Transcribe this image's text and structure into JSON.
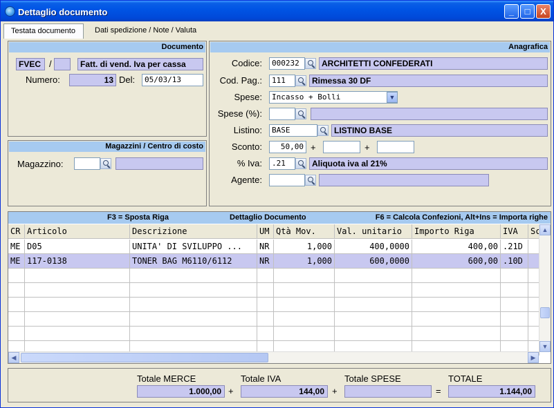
{
  "window": {
    "title": "Dettaglio documento",
    "min_glyph": "_",
    "max_glyph": "□",
    "close_glyph": "X"
  },
  "tabs": [
    {
      "label": "Testata documento",
      "active": true
    },
    {
      "label": "Dati spedizione / Note / Valuta",
      "active": false
    }
  ],
  "documento": {
    "header": "Documento",
    "tipo": "FVEC",
    "separator": "/",
    "sezionale": "",
    "descrizione_tipo": "Fatt. di vend. Iva per cassa",
    "numero_label": "Numero:",
    "numero": "13",
    "del_label": "Del:",
    "data": "05/03/13"
  },
  "magazzini": {
    "header": "Magazzini / Centro di costo",
    "magazzino_label": "Magazzino:",
    "magazzino_value": "",
    "magazzino_desc": ""
  },
  "anagrafica": {
    "header": "Anagrafica",
    "codice_label": "Codice:",
    "codice": "000232",
    "codice_desc": "ARCHITETTI CONFEDERATI",
    "codpag_label": "Cod. Pag.:",
    "codpag": "111",
    "codpag_desc": "Rimessa 30 DF",
    "spese_label": "Spese:",
    "spese": "Incasso + Bolli",
    "spese_perc_label": "Spese (%):",
    "spese_perc": "",
    "spese_perc_desc": "",
    "listino_label": "Listino:",
    "listino": "BASE",
    "listino_desc": "LISTINO BASE",
    "sconto_label": "Sconto:",
    "sconto1": "50,00",
    "plus": "+",
    "sconto2": "",
    "sconto3": "",
    "iva_label": "% Iva:",
    "iva": ".21",
    "iva_desc": "Aliquota iva al 21%",
    "agente_label": "Agente:",
    "agente": "",
    "agente_desc": ""
  },
  "grid": {
    "header_left": "F3 = Sposta Riga",
    "header_center": "Dettaglio Documento",
    "header_right": "F6 = Calcola Confezioni, Alt+Ins = Importa righe",
    "columns": [
      "CR",
      "Articolo",
      "Descrizione",
      "UM",
      "Qtà Mov.",
      "Val. unitario",
      "Importo Riga",
      "IVA",
      "Sc"
    ],
    "rows": [
      [
        "ME",
        "D05",
        "UNITA' DI SVILUPPO ...",
        "NR",
        "1,000",
        "400,0000",
        "400,00",
        ".21D"
      ],
      [
        "ME",
        "117-0138",
        "TONER BAG M6110/6112",
        "NR",
        "1,000",
        "600,0000",
        "600,00",
        ".10D"
      ]
    ],
    "selected_row": 1
  },
  "totals": {
    "merce_label": "Totale MERCE",
    "merce": "1.000,00",
    "iva_label": "Totale IVA",
    "iva": "144,00",
    "spese_label": "Totale SPESE",
    "spese": "",
    "totale_label": "TOTALE",
    "totale": "1.144,00",
    "plus": "+",
    "equals": "="
  },
  "colors": {
    "titlebar": "#0055e5",
    "panel_header": "#a6caf0",
    "readonly_field": "#c8c8f0",
    "selected_row": "#c8c8f0"
  }
}
